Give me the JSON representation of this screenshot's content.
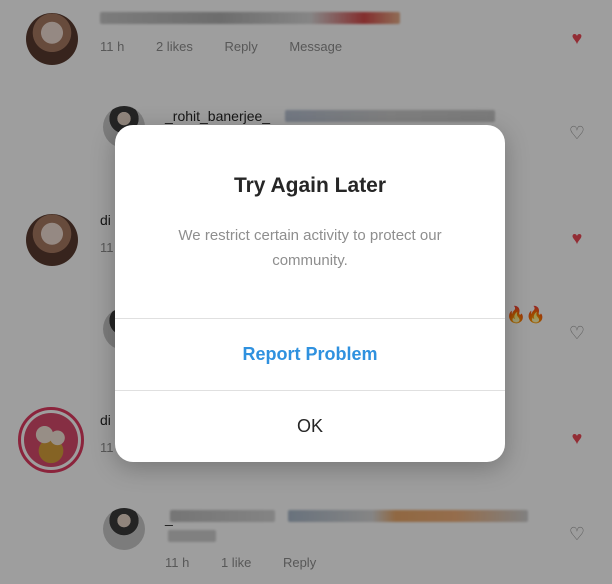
{
  "background_comments": [
    {
      "username": "",
      "meta": [
        "11 h",
        "2 likes",
        "Reply",
        "Message"
      ],
      "liked": true
    },
    {
      "username": "_rohit_banerjee_",
      "meta": [],
      "liked": false
    },
    {
      "username": "di",
      "meta": [
        "11"
      ],
      "liked": true
    },
    {
      "username": "",
      "meta": [],
      "liked": false,
      "emoji": "🔥🔥"
    },
    {
      "username": "di",
      "meta": [
        "11"
      ],
      "liked": true
    },
    {
      "username": "_",
      "meta": [
        "11 h",
        "1 like",
        "Reply"
      ],
      "liked": false
    }
  ],
  "dialog": {
    "title": "Try Again Later",
    "message": "We restrict certain activity to protect our community.",
    "report_button": "Report Problem",
    "ok_button": "OK"
  },
  "icons": {
    "heart_filled": "heart-filled-icon",
    "heart_outline": "heart-outline-icon"
  },
  "colors": {
    "like_red": "#ed4956",
    "link_blue": "#2f91df",
    "overlay": "rgba(0,0,0,0.38)"
  }
}
